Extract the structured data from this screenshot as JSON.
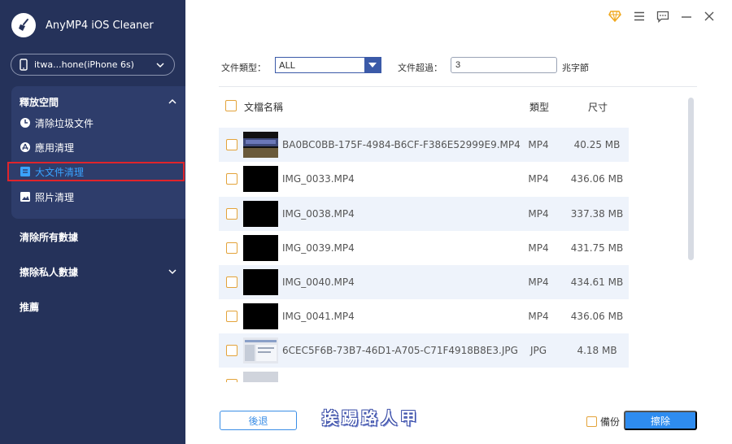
{
  "app": {
    "title": "AnyMP4 iOS Cleaner"
  },
  "device": {
    "label": "itwa...hone(iPhone 6s)"
  },
  "sidebar": {
    "free_space": {
      "title": "釋放空間",
      "items": [
        {
          "label": "清除垃圾文件"
        },
        {
          "label": "應用清理"
        },
        {
          "label": "大文件清理"
        },
        {
          "label": "照片清理"
        }
      ]
    },
    "erase_all": {
      "label": "清除所有數據"
    },
    "erase_private": {
      "label": "擦除私人數據"
    },
    "recommend": {
      "label": "推薦"
    }
  },
  "filters": {
    "type_label": "文件類型：",
    "type_value": "ALL",
    "size_label": "文件超過：",
    "size_value": "3",
    "size_unit": "兆字節"
  },
  "table": {
    "columns": {
      "name": "文檔名稱",
      "type": "類型",
      "size": "尺寸"
    },
    "rows": [
      {
        "name": "BA0BC0BB-175F-4984-B6CF-F386E52999E9.MP4",
        "type": "MP4",
        "size": "40.25 MB"
      },
      {
        "name": "IMG_0033.MP4",
        "type": "MP4",
        "size": "436.06 MB"
      },
      {
        "name": "IMG_0038.MP4",
        "type": "MP4",
        "size": "337.38 MB"
      },
      {
        "name": "IMG_0039.MP4",
        "type": "MP4",
        "size": "431.75 MB"
      },
      {
        "name": "IMG_0040.MP4",
        "type": "MP4",
        "size": "434.61 MB"
      },
      {
        "name": "IMG_0041.MP4",
        "type": "MP4",
        "size": "436.06 MB"
      },
      {
        "name": "6CEC5F6B-73B7-46D1-A705-C71F4918B8E3.JPG",
        "type": "JPG",
        "size": "4.18 MB"
      }
    ]
  },
  "footer": {
    "back_label": "後退",
    "watermark": "挨踢路人甲",
    "backup_label": "備份",
    "erase_label": "擦除"
  },
  "colors": {
    "sidebar": "#25325a",
    "accent": "#2e8cf0",
    "checkbox": "#e3a33a",
    "active_outline": "#e0242b"
  }
}
